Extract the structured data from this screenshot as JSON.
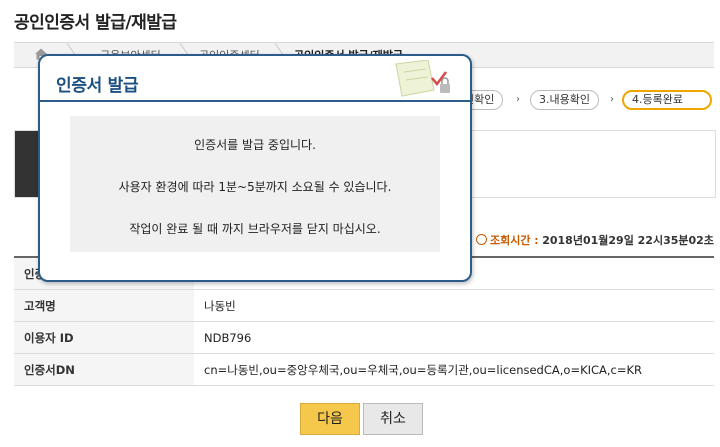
{
  "page": {
    "title": "공인인증서 발급/재발급"
  },
  "breadcrumb": {
    "items": [
      "금융보안센터",
      "공인인증센터",
      "공인인증서 발급/재발급"
    ]
  },
  "steps": [
    {
      "label": "인확인"
    },
    {
      "label": "3.내용확인"
    },
    {
      "label": "4.등록완료"
    }
  ],
  "timer": {
    "label": "조회시간 :",
    "value": "2018년01월29일 22시35분02초"
  },
  "info_table": {
    "rows": [
      {
        "label": "인증",
        "value": ""
      },
      {
        "label": "고객명",
        "value": "나동빈"
      },
      {
        "label": "이용자 ID",
        "value": "NDB796"
      },
      {
        "label": "인증서DN",
        "value": "cn=나동빈,ou=중앙우체국,ou=우체국,ou=등록기관,ou=licensedCA,o=KICA,c=KR"
      }
    ]
  },
  "buttons": {
    "next": "다음",
    "cancel": "취소"
  },
  "modal": {
    "title": "인증서 발급",
    "messages": [
      "인증서를 발급 중입니다.",
      "사용자 환경에 따라 1분~5분까지 소요될 수 있습니다.",
      "작업이 완료 될 때 까지 브라우저를 닫지 마십시오."
    ]
  },
  "colors": {
    "accent": "#2a5d8a",
    "button_primary": "#f5c84c",
    "active_step": "#f0a500"
  }
}
